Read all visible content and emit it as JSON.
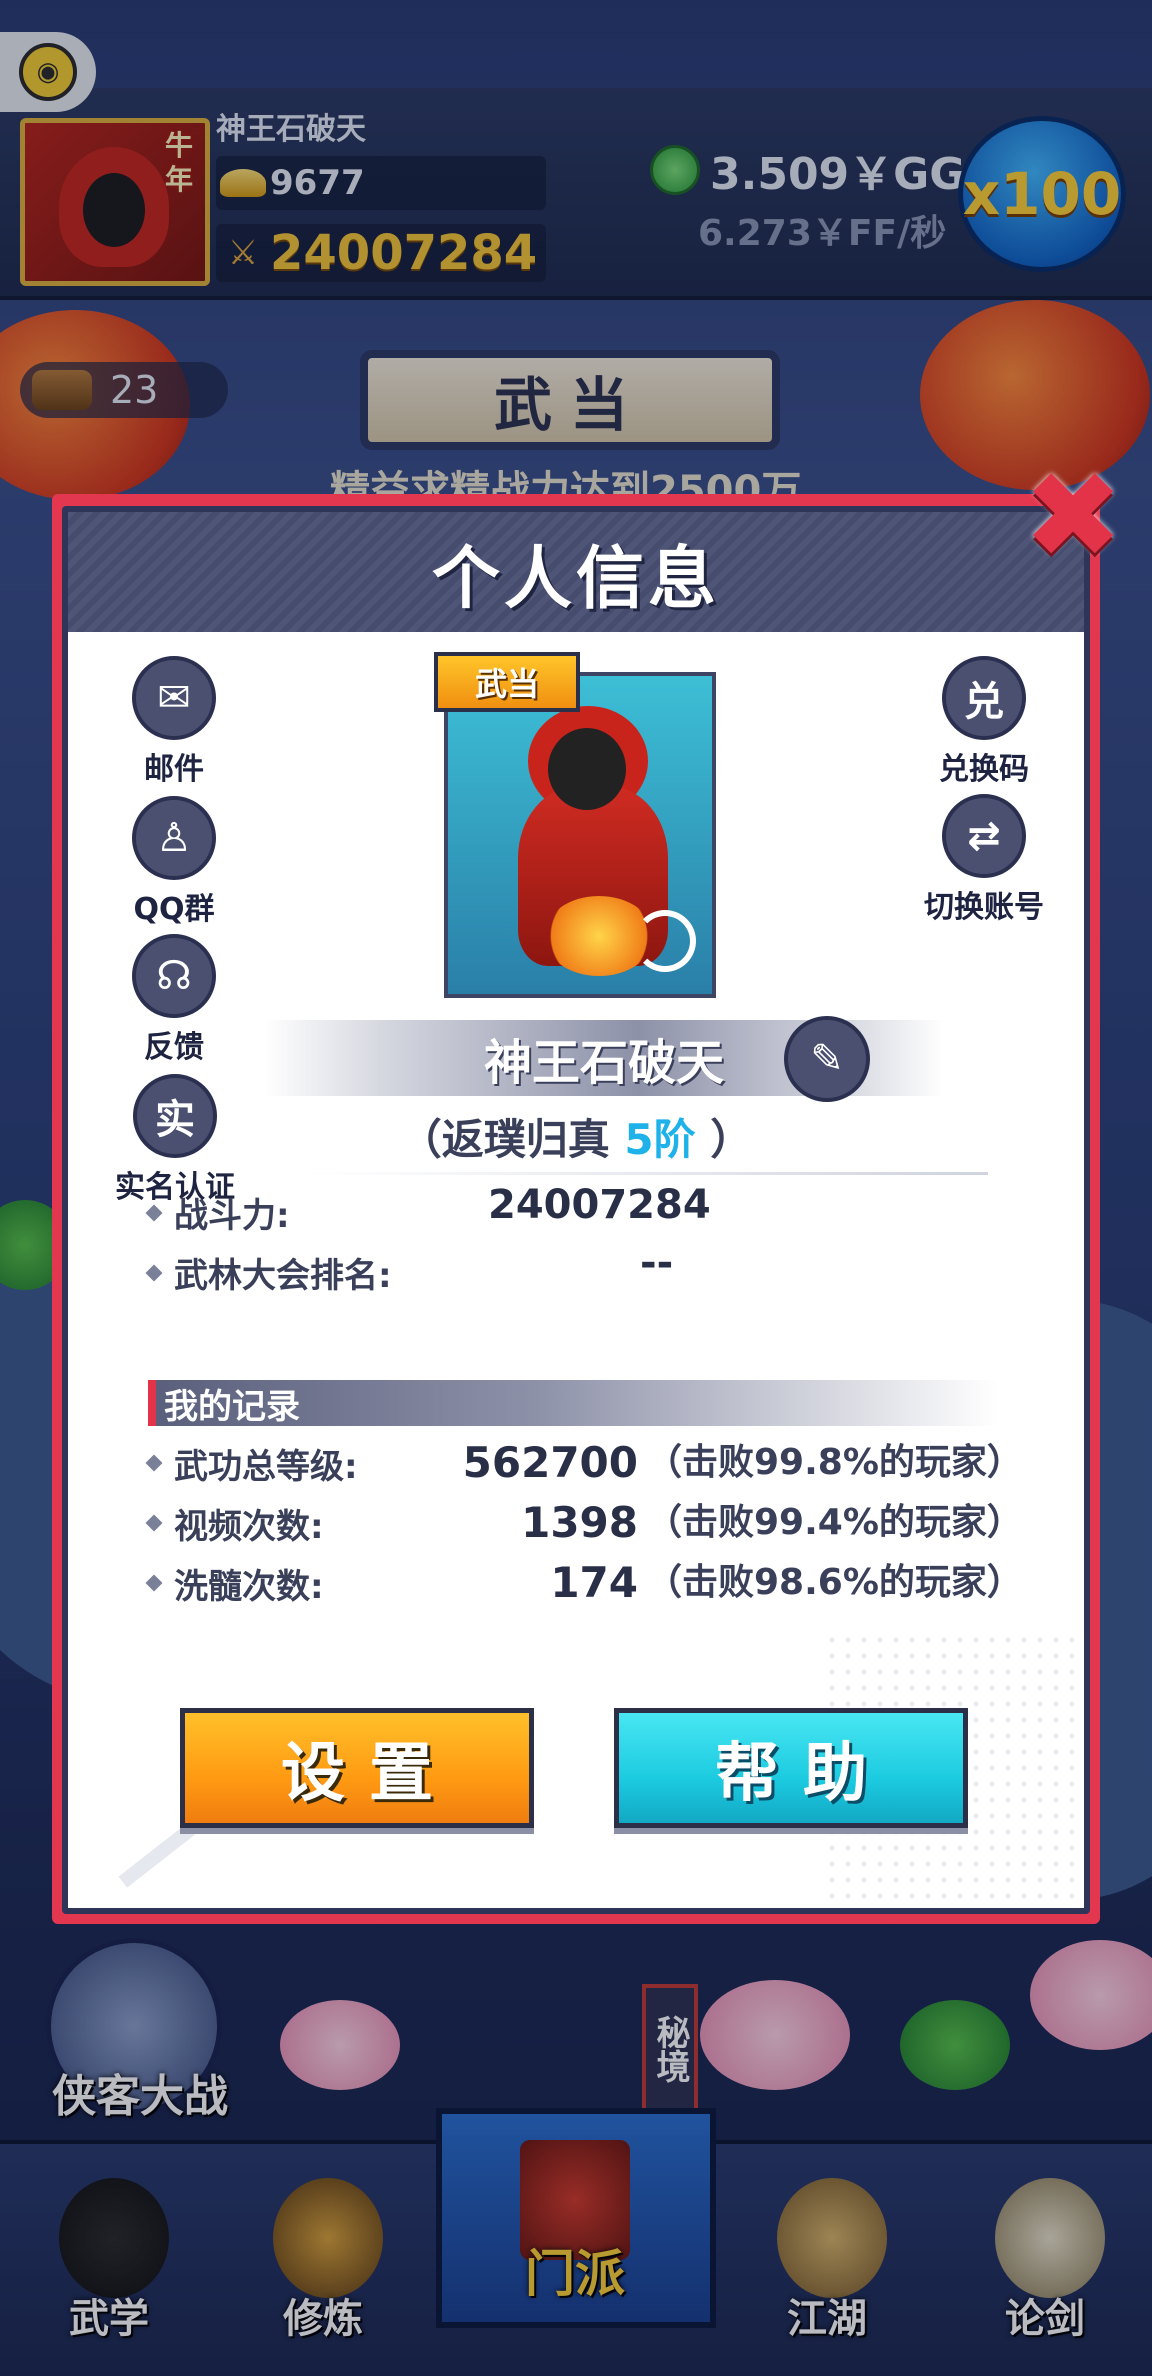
{
  "topbar": {
    "player_name": "神王石破天",
    "avatar_badge": "牛年",
    "gold": "9677",
    "power": "24007284",
    "currency_amount": "3.509￥GG",
    "currency_rate": "6.273￥FF/秒",
    "multiplier": "x100"
  },
  "scene": {
    "wood_count": "23",
    "sect_banner": "武当",
    "mission_text": "精益求精战力达到2500万"
  },
  "modal": {
    "title": "个人信息",
    "left_buttons": [
      {
        "label": "邮件",
        "icon": "mail-icon",
        "glyph": "✉"
      },
      {
        "label": "QQ群",
        "icon": "qq-penguin-icon",
        "glyph": "♙"
      },
      {
        "label": "反馈",
        "icon": "headset-icon",
        "glyph": "☊"
      },
      {
        "label": "实名认证",
        "icon": "real-name-icon",
        "glyph": "实"
      }
    ],
    "right_buttons": [
      {
        "label": "兑换码",
        "icon": "redeem-icon",
        "glyph": "兑"
      },
      {
        "label": "切换账号",
        "icon": "switch-account-icon",
        "glyph": "⇄"
      }
    ],
    "sect_tag": "武当",
    "name": "神王石破天",
    "rank_prefix": "（返璞归真",
    "rank_level": "5阶",
    "rank_suffix": "）",
    "stats": [
      {
        "label": "战斗力:",
        "value": "24007284"
      },
      {
        "label": "武林大会排名:",
        "value": "--"
      }
    ],
    "records_title": "我的记录",
    "records": [
      {
        "label": "武功总等级:",
        "value": "562700",
        "percent": "（击败99.8%的玩家）"
      },
      {
        "label": "视频次数:",
        "value": "1398",
        "percent": "（击败99.4%的玩家）"
      },
      {
        "label": "洗髓次数:",
        "value": "174",
        "percent": "（击败98.6%的玩家）"
      }
    ],
    "settings_label": "设置",
    "help_label": "帮助"
  },
  "bottom_nav": {
    "heroes_label": "侠客大战",
    "secret_label": "秘境",
    "items": [
      "武学",
      "修炼",
      "门派",
      "江湖",
      "论剑"
    ],
    "active": "门派"
  }
}
